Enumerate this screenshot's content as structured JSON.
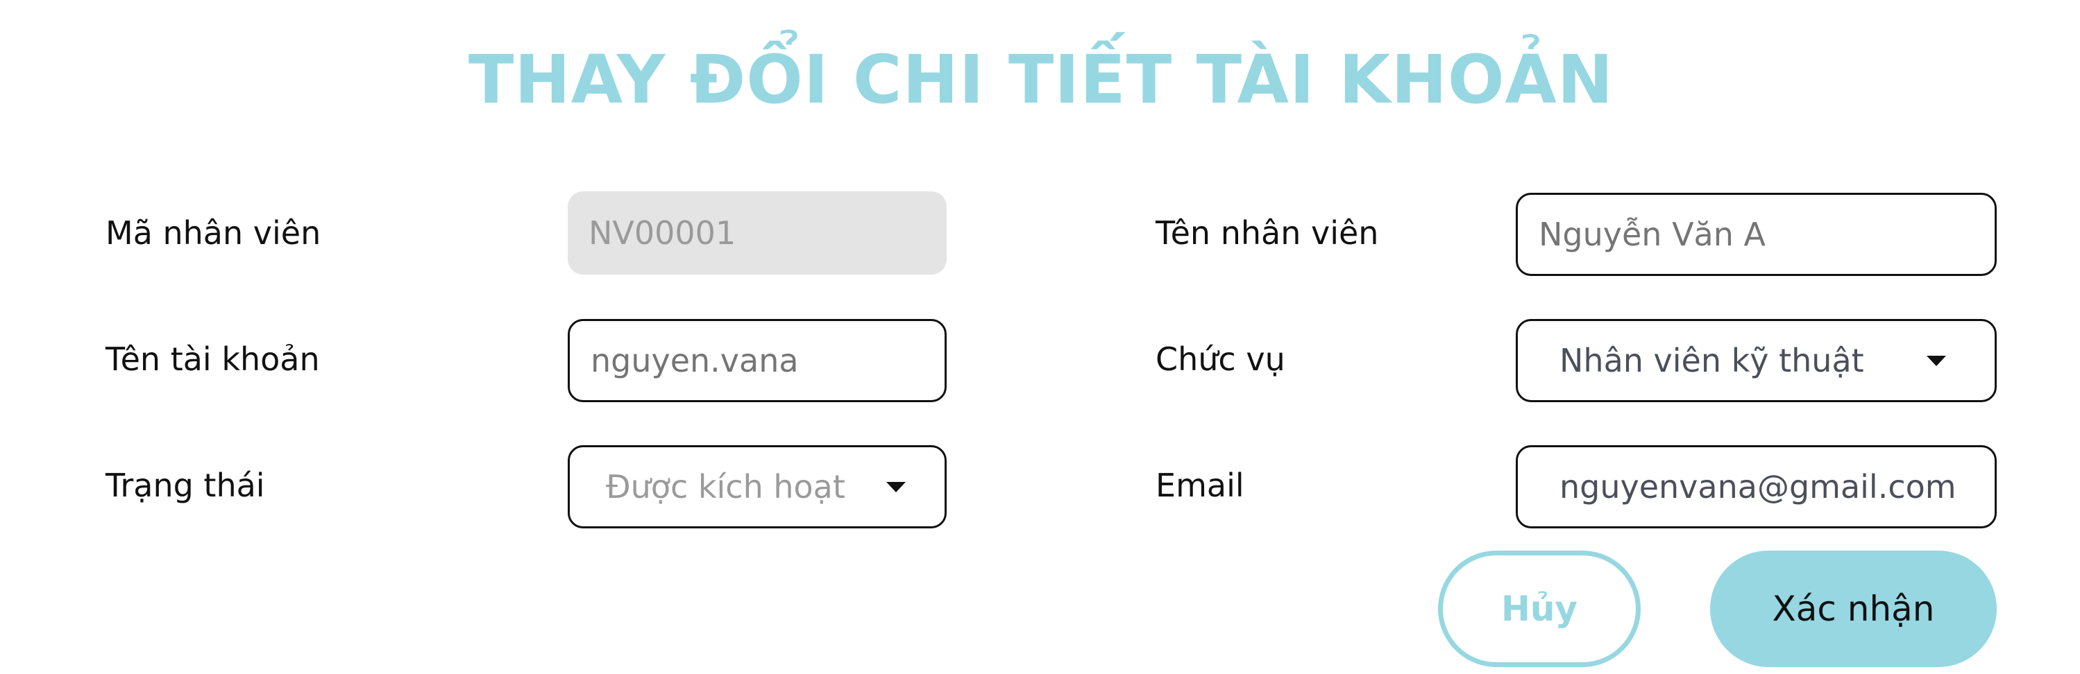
{
  "form": {
    "title": "THAY ĐỔI CHI TIẾT TÀI KHOẢN",
    "employee_id": {
      "label": "Mã nhân viên",
      "value": "NV00001"
    },
    "employee_name": {
      "label": "Tên nhân viên",
      "placeholder": "Nguyễn Văn A"
    },
    "username": {
      "label": "Tên tài khoản",
      "placeholder": "nguyen.vana"
    },
    "position": {
      "label": "Chức vụ",
      "value": "Nhân viên kỹ thuật"
    },
    "status": {
      "label": "Trạng thái",
      "value": "Được kích hoạt"
    },
    "email": {
      "label": "Email",
      "value": "nguyenvana@gmail.com"
    },
    "buttons": {
      "cancel": "Hủy",
      "confirm": "Xác nhận"
    },
    "colors": {
      "accent": "#96d7e2",
      "disabled_bg": "#e4e4e4"
    }
  }
}
